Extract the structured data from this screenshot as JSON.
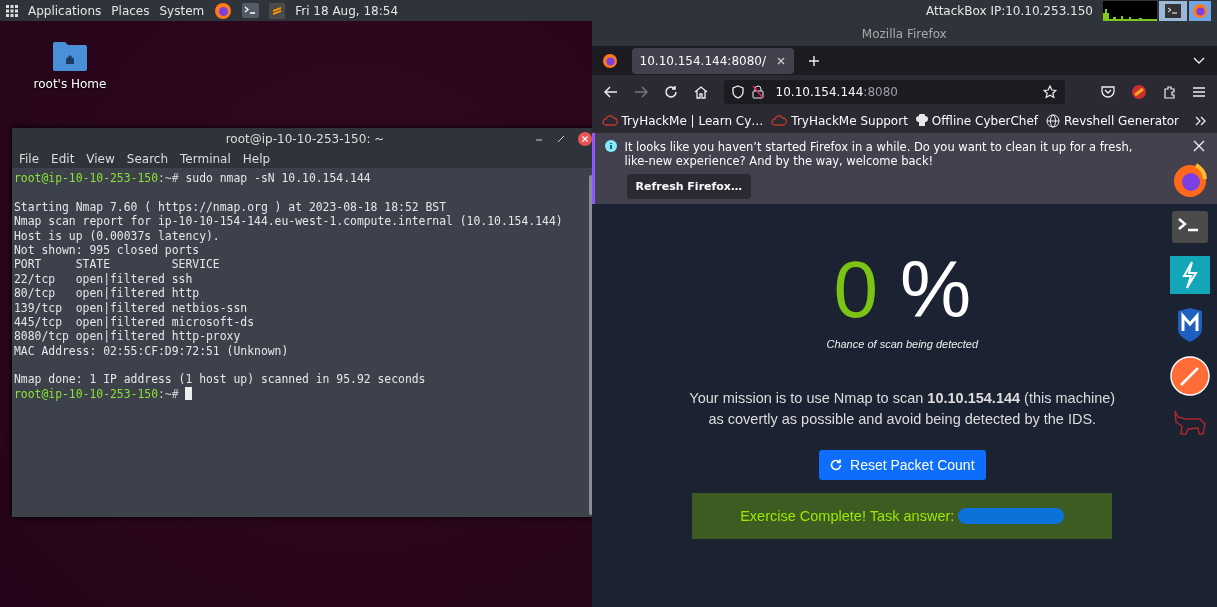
{
  "top_panel": {
    "menus": [
      "Applications",
      "Places",
      "System"
    ],
    "clock": "Fri 18 Aug, 18:54",
    "attackbox_ip": "AttackBox IP:10.10.253.150"
  },
  "desktop": {
    "icons": [
      {
        "label": "root's Home"
      }
    ]
  },
  "terminal": {
    "title": "root@ip-10-10-253-150: ~",
    "menu": [
      "File",
      "Edit",
      "View",
      "Search",
      "Terminal",
      "Help"
    ],
    "lines": [
      {
        "kind": "prompt",
        "user_host": "root@ip-10-10-253-150",
        "path": ":~#",
        "command": "sudo nmap -sN 10.10.154.144"
      },
      {
        "kind": "blank"
      },
      {
        "kind": "output",
        "text": "Starting Nmap 7.60 ( https://nmap.org ) at 2023-08-18 18:52 BST"
      },
      {
        "kind": "output",
        "text": "Nmap scan report for ip-10-10-154-144.eu-west-1.compute.internal (10.10.154.144)"
      },
      {
        "kind": "output",
        "text": "Host is up (0.00037s latency)."
      },
      {
        "kind": "output",
        "text": "Not shown: 995 closed ports"
      },
      {
        "kind": "output",
        "text": "PORT     STATE         SERVICE"
      },
      {
        "kind": "output",
        "text": "22/tcp   open|filtered ssh"
      },
      {
        "kind": "output",
        "text": "80/tcp   open|filtered http"
      },
      {
        "kind": "output",
        "text": "139/tcp  open|filtered netbios-ssn"
      },
      {
        "kind": "output",
        "text": "445/tcp  open|filtered microsoft-ds"
      },
      {
        "kind": "output",
        "text": "8080/tcp open|filtered http-proxy"
      },
      {
        "kind": "output",
        "text": "MAC Address: 02:55:CF:D9:72:51 (Unknown)"
      },
      {
        "kind": "blank"
      },
      {
        "kind": "output",
        "text": "Nmap done: 1 IP address (1 host up) scanned in 95.92 seconds"
      },
      {
        "kind": "prompt",
        "user_host": "root@ip-10-10-253-150",
        "path": ":~#",
        "cursor": true
      }
    ]
  },
  "firefox": {
    "window_title": "Mozilla Firefox",
    "tabs": [
      {
        "label": "10.10.154.144:8080/",
        "selected": true
      }
    ],
    "url_host": "10.10.154.144",
    "url_port": ":8080",
    "bookmarks": [
      {
        "kind": "cloud",
        "label": "TryHackMe | Learn Cy…"
      },
      {
        "kind": "cloud",
        "label": "TryHackMe Support"
      },
      {
        "kind": "chef",
        "label": "Offline CyberChef"
      },
      {
        "kind": "globe",
        "label": "Revshell Generator"
      }
    ],
    "notification": {
      "message": "It looks like you haven’t started Firefox in a while. Do you want to clean it up for a fresh, like-new experience? And by the way, welcome back!",
      "button": "Refresh Firefox…"
    },
    "page": {
      "percent_value": "0",
      "percent_sign": "%",
      "caption": "Chance of scan being detected",
      "mission": "Your mission is to use Nmap to scan **10.10.154.144** (this machine) as covertly as possible and avoid being detected by the IDS.",
      "reset_button": "Reset Packet Count",
      "result": "Exercise Complete! Task answer:"
    }
  }
}
